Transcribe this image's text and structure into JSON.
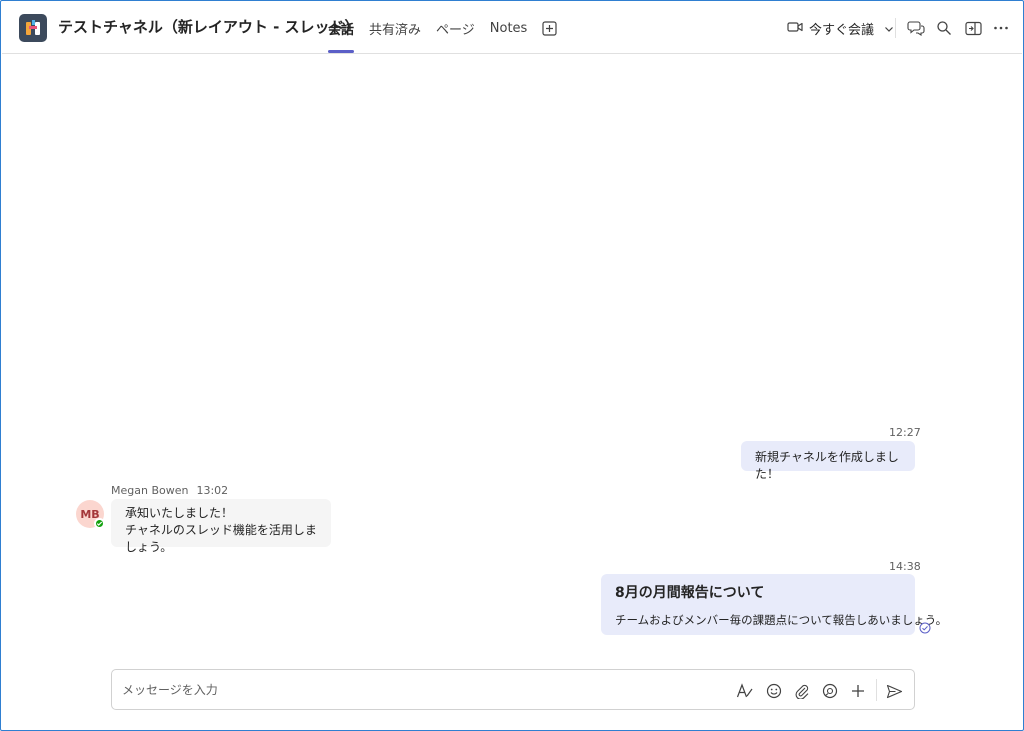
{
  "header": {
    "channel_title": "テストチャネル（新レイアウト - スレッド）",
    "tabs": [
      {
        "label": "会話",
        "active": true
      },
      {
        "label": "共有済み",
        "active": false
      },
      {
        "label": "ページ",
        "active": false
      },
      {
        "label": "Notes",
        "active": false
      }
    ],
    "meet_label": "今すぐ会議",
    "icons": [
      "team-avatar-icon",
      "add-tab-icon",
      "video-icon",
      "chevron-down-icon",
      "chat-icon",
      "search-icon",
      "panel-icon",
      "more-icon"
    ]
  },
  "messages": [
    {
      "time": "12:27",
      "text": "新規チャネルを作成しました！"
    },
    {
      "sender": "Megan Bowen",
      "initials": "MB",
      "time": "13:02",
      "lines": [
        "承知いたしました！",
        "チャネルのスレッド機能を活用しましょう。"
      ]
    },
    {
      "time": "14:38",
      "subject": "8月の月間報告について",
      "text": "チームおよびメンバー毎の課題点について報告しあいましょう。"
    }
  ],
  "compose": {
    "placeholder": "メッセージを入力"
  },
  "colors": {
    "accent": "#5b5fc7",
    "mine_bubble": "#e8ebfa",
    "other_bubble": "#f5f5f5",
    "presence": "#13a10e",
    "window_border": "#2f7fd1"
  }
}
